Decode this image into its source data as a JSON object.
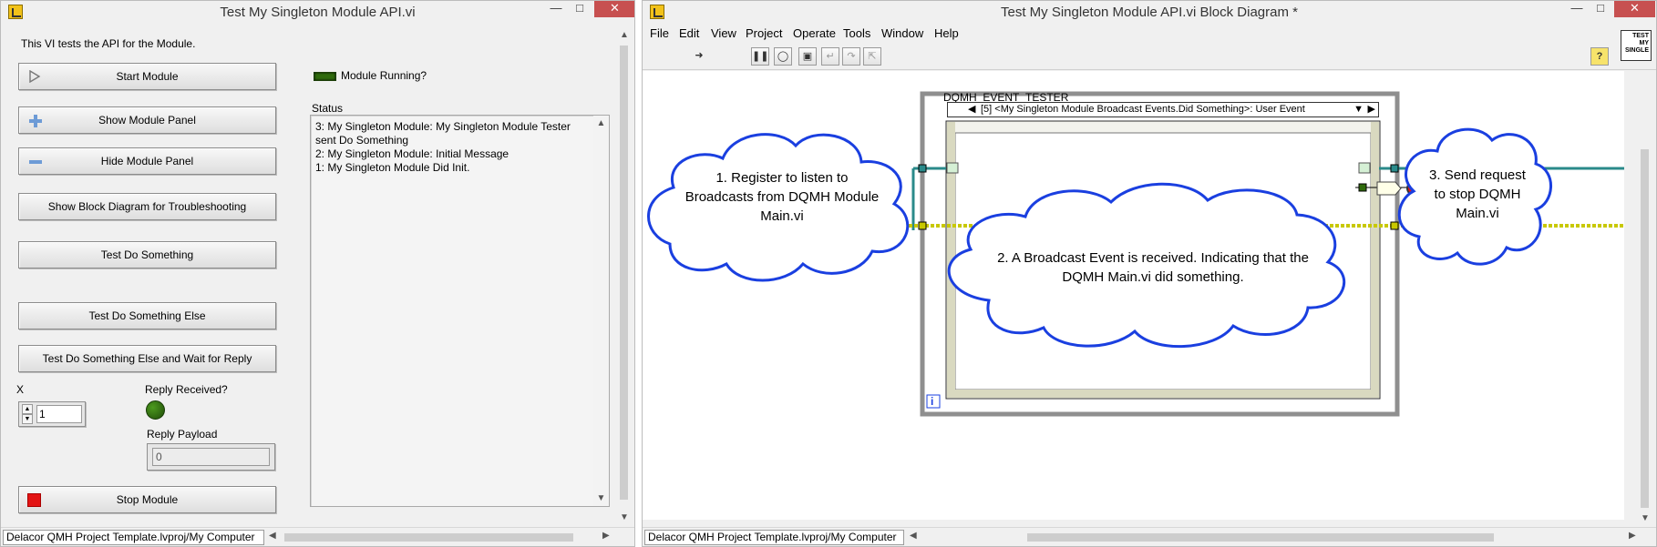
{
  "front_panel": {
    "window_title": "Test My Singleton Module API.vi",
    "description": "This VI tests the API for the Module.",
    "buttons": {
      "start_module": "Start Module",
      "show_module_panel": "Show Module Panel",
      "hide_module_panel": "Hide Module Panel",
      "show_block_diagram": "Show Block Diagram for Troubleshooting",
      "test_do_something": "Test Do Something",
      "test_do_something_else": "Test Do Something Else",
      "test_do_something_else_wait": "Test Do Something Else and Wait for Reply",
      "stop_module": "Stop Module"
    },
    "module_running_label": "Module Running?",
    "status_label": "Status",
    "status_text": "3: My Singleton Module: My Singleton Module Tester sent Do Something\n2: My Singleton Module: Initial Message\n1: My Singleton Module Did Init.",
    "x_label": "X",
    "x_value": "1",
    "reply_received_label": "Reply Received?",
    "reply_payload_label": "Reply Payload",
    "reply_payload_value": "0",
    "project_path": "Delacor QMH Project Template.lvproj/My Computer",
    "colors": {
      "led_off": "#2f6a0c",
      "stop_square": "#e31414"
    }
  },
  "block_diagram": {
    "window_title": "Test My Singleton Module API.vi Block Diagram *",
    "menu": [
      "File",
      "Edit",
      "View",
      "Project",
      "Operate",
      "Tools",
      "Window",
      "Help"
    ],
    "toolbar_icons": [
      "run-arrow-icon",
      "pause-icon",
      "highlight-execution-icon",
      "retain-wire-values-icon",
      "step-into-icon",
      "step-over-icon",
      "step-out-icon"
    ],
    "structure_label": "DQMH_EVENT_TESTER",
    "event_case_label": "[5] <My Singleton Module Broadcast Events.Did Something>: User Event",
    "loop_index_label": "i",
    "clouds": {
      "c1": "1. Register to listen to\nBroadcasts from DQMH Module\nMain.vi",
      "c2": "2. A Broadcast Event is received. Indicating that the\nDQMH Main.vi did something.",
      "c3": "3. Send request\nto stop DQMH\nMain.vi"
    },
    "vi_icon_text": "TEST MY SINGLE",
    "project_path": "Delacor QMH Project Template.lvproj/My Computer",
    "colors": {
      "cloud_stroke": "#1a3fe0",
      "wire_yellow": "#c8c800",
      "wire_teal": "#2a8a8a",
      "structure_gray": "#8f8f8f"
    }
  }
}
